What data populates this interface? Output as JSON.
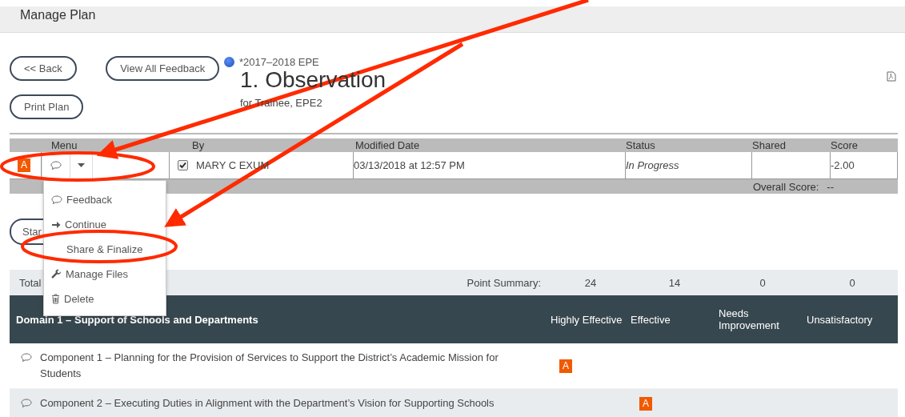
{
  "header": {
    "title": "Manage Plan"
  },
  "buttons": [
    {
      "label": "<< Back"
    },
    {
      "label": "View All Feedback"
    },
    {
      "label": "Print Plan"
    }
  ],
  "plan": {
    "tag": "*2017–2018 EPE",
    "title": "1. Observation",
    "subtitle": "for Trainee, EPE2"
  },
  "table": {
    "columns": [
      "Menu",
      "By",
      "Modified Date",
      "Status",
      "Shared",
      "Score"
    ],
    "row": {
      "badge": "A",
      "checked": true,
      "by": "MARY C EXUM",
      "date": "03/13/2018 at 12:57 PM",
      "status": "In Progress",
      "score": "-2.00"
    },
    "overall": {
      "label": "Overall Score:",
      "value": "--"
    }
  },
  "menu": [
    {
      "kind": "comment",
      "label": "Feedback"
    },
    {
      "kind": "arrow",
      "label": "Continue"
    },
    {
      "kind": "plain",
      "label": "Share & Finalize"
    },
    {
      "kind": "wrench",
      "label": "Manage Files"
    },
    {
      "kind": "trash",
      "label": "Delete"
    }
  ],
  "start_button": {
    "label": "Star"
  },
  "summary": {
    "total": "Total",
    "label": "Point Summary:",
    "values": [
      "24",
      "14",
      "0",
      "0"
    ]
  },
  "domain": {
    "title": "Domain 1 – Support of Schools and Departments",
    "columns": [
      "Highly Effective",
      "Effective",
      "Needs Improvement",
      "Unsatisfactory"
    ],
    "components": [
      {
        "title": "Component 1 – Planning for the Provision of Services to Support the District’s Academic Mission for Students",
        "cells": [
          {
            "selected": true,
            "badge": "A"
          },
          {
            "selected": false
          },
          {
            "selected": false
          },
          {
            "selected": false
          }
        ]
      },
      {
        "title": "Component 2 – Executing Duties in Alignment with the Department’s Vision for Supporting Schools",
        "cells": [
          {
            "selected": false
          },
          {
            "selected": true,
            "badge": "A"
          },
          {
            "selected": false
          },
          {
            "selected": false
          }
        ]
      }
    ]
  }
}
